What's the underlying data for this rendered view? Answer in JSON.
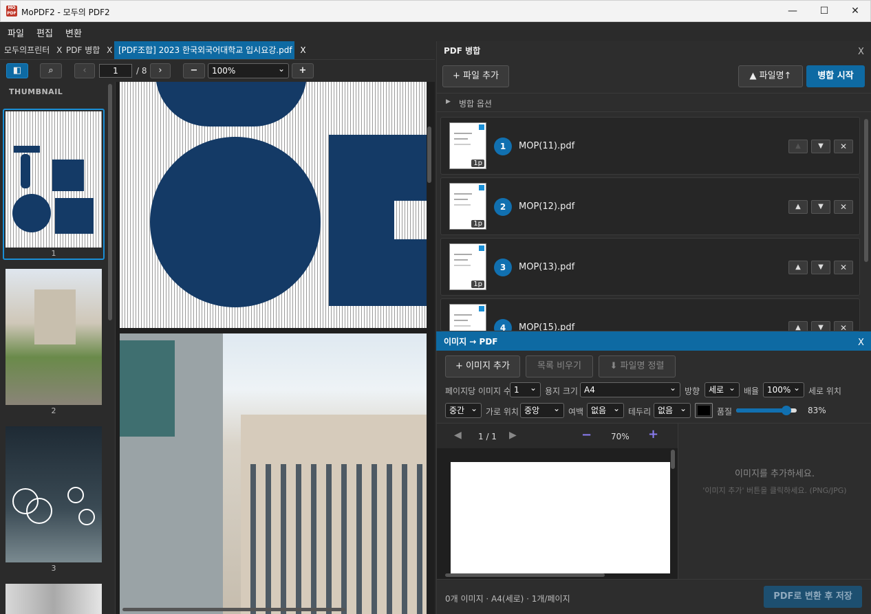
{
  "window": {
    "title": "MoPDF2 - 모두의 PDF2",
    "icon_text": "MO PDF"
  },
  "menu": [
    "파일",
    "편집",
    "변환"
  ],
  "tabs": [
    {
      "label": "모두의프린터",
      "close": "X"
    },
    {
      "label": "PDF 병합",
      "close": "X"
    },
    {
      "label": "[PDF조합] 2023 한국외국어대학교 입시요강.pdf",
      "close": "X"
    }
  ],
  "viewer_toolbar": {
    "page_value": "1",
    "page_total": "/ 8",
    "zoom": "100%"
  },
  "thumbnails": {
    "header": "THUMBNAIL",
    "labels": [
      "1",
      "2",
      "3"
    ]
  },
  "merge": {
    "title": "PDF 병합",
    "close": "X",
    "add_button": "+ 파일 추가",
    "sort_button": "▲ 파일명↑",
    "start_button": "병합 시작",
    "options_label": "병합 옵션",
    "files": [
      {
        "index": "1",
        "name": "MOP(11).pdf",
        "pages": "1p"
      },
      {
        "index": "2",
        "name": "MOP(12).pdf",
        "pages": "1p"
      },
      {
        "index": "3",
        "name": "MOP(13).pdf",
        "pages": "1p"
      },
      {
        "index": "4",
        "name": "MOP(15).pdf",
        "pages": "1p"
      }
    ]
  },
  "img2pdf": {
    "title": "이미지 → PDF",
    "close": "X",
    "add_button": "+ 이미지 추가",
    "clear_button": "목록 비우기",
    "sort_button": "⬇ 파일명 정렬",
    "labels": {
      "per_page": "페이지당 이미지 수",
      "paper": "용지 크기",
      "orientation": "방향",
      "scale": "배율",
      "valign": "세로 위치",
      "halign": "가로 위치",
      "margin": "여백",
      "border": "테두리",
      "quality": "품질"
    },
    "values": {
      "per_page": "1",
      "paper": "A4",
      "orientation": "세로",
      "scale": "100%",
      "valign": "중간",
      "halign": "중앙",
      "margin": "없음",
      "border": "없음",
      "quality": "83%",
      "quality_fraction": 0.83
    },
    "preview": {
      "page": "1 / 1",
      "zoom": "70%"
    },
    "empty_title": "이미지를 추가하세요.",
    "empty_hint": "'이미지 추가' 버튼을 클릭하세요. (PNG/JPG)",
    "status": "0개 이미지 · A4(세로) · 1개/페이지",
    "convert_button": "PDF로 변환 후 저장"
  },
  "colors": {
    "accent": "#0e6aa3",
    "navy": "#143a66",
    "purple": "#8a7cf0"
  }
}
